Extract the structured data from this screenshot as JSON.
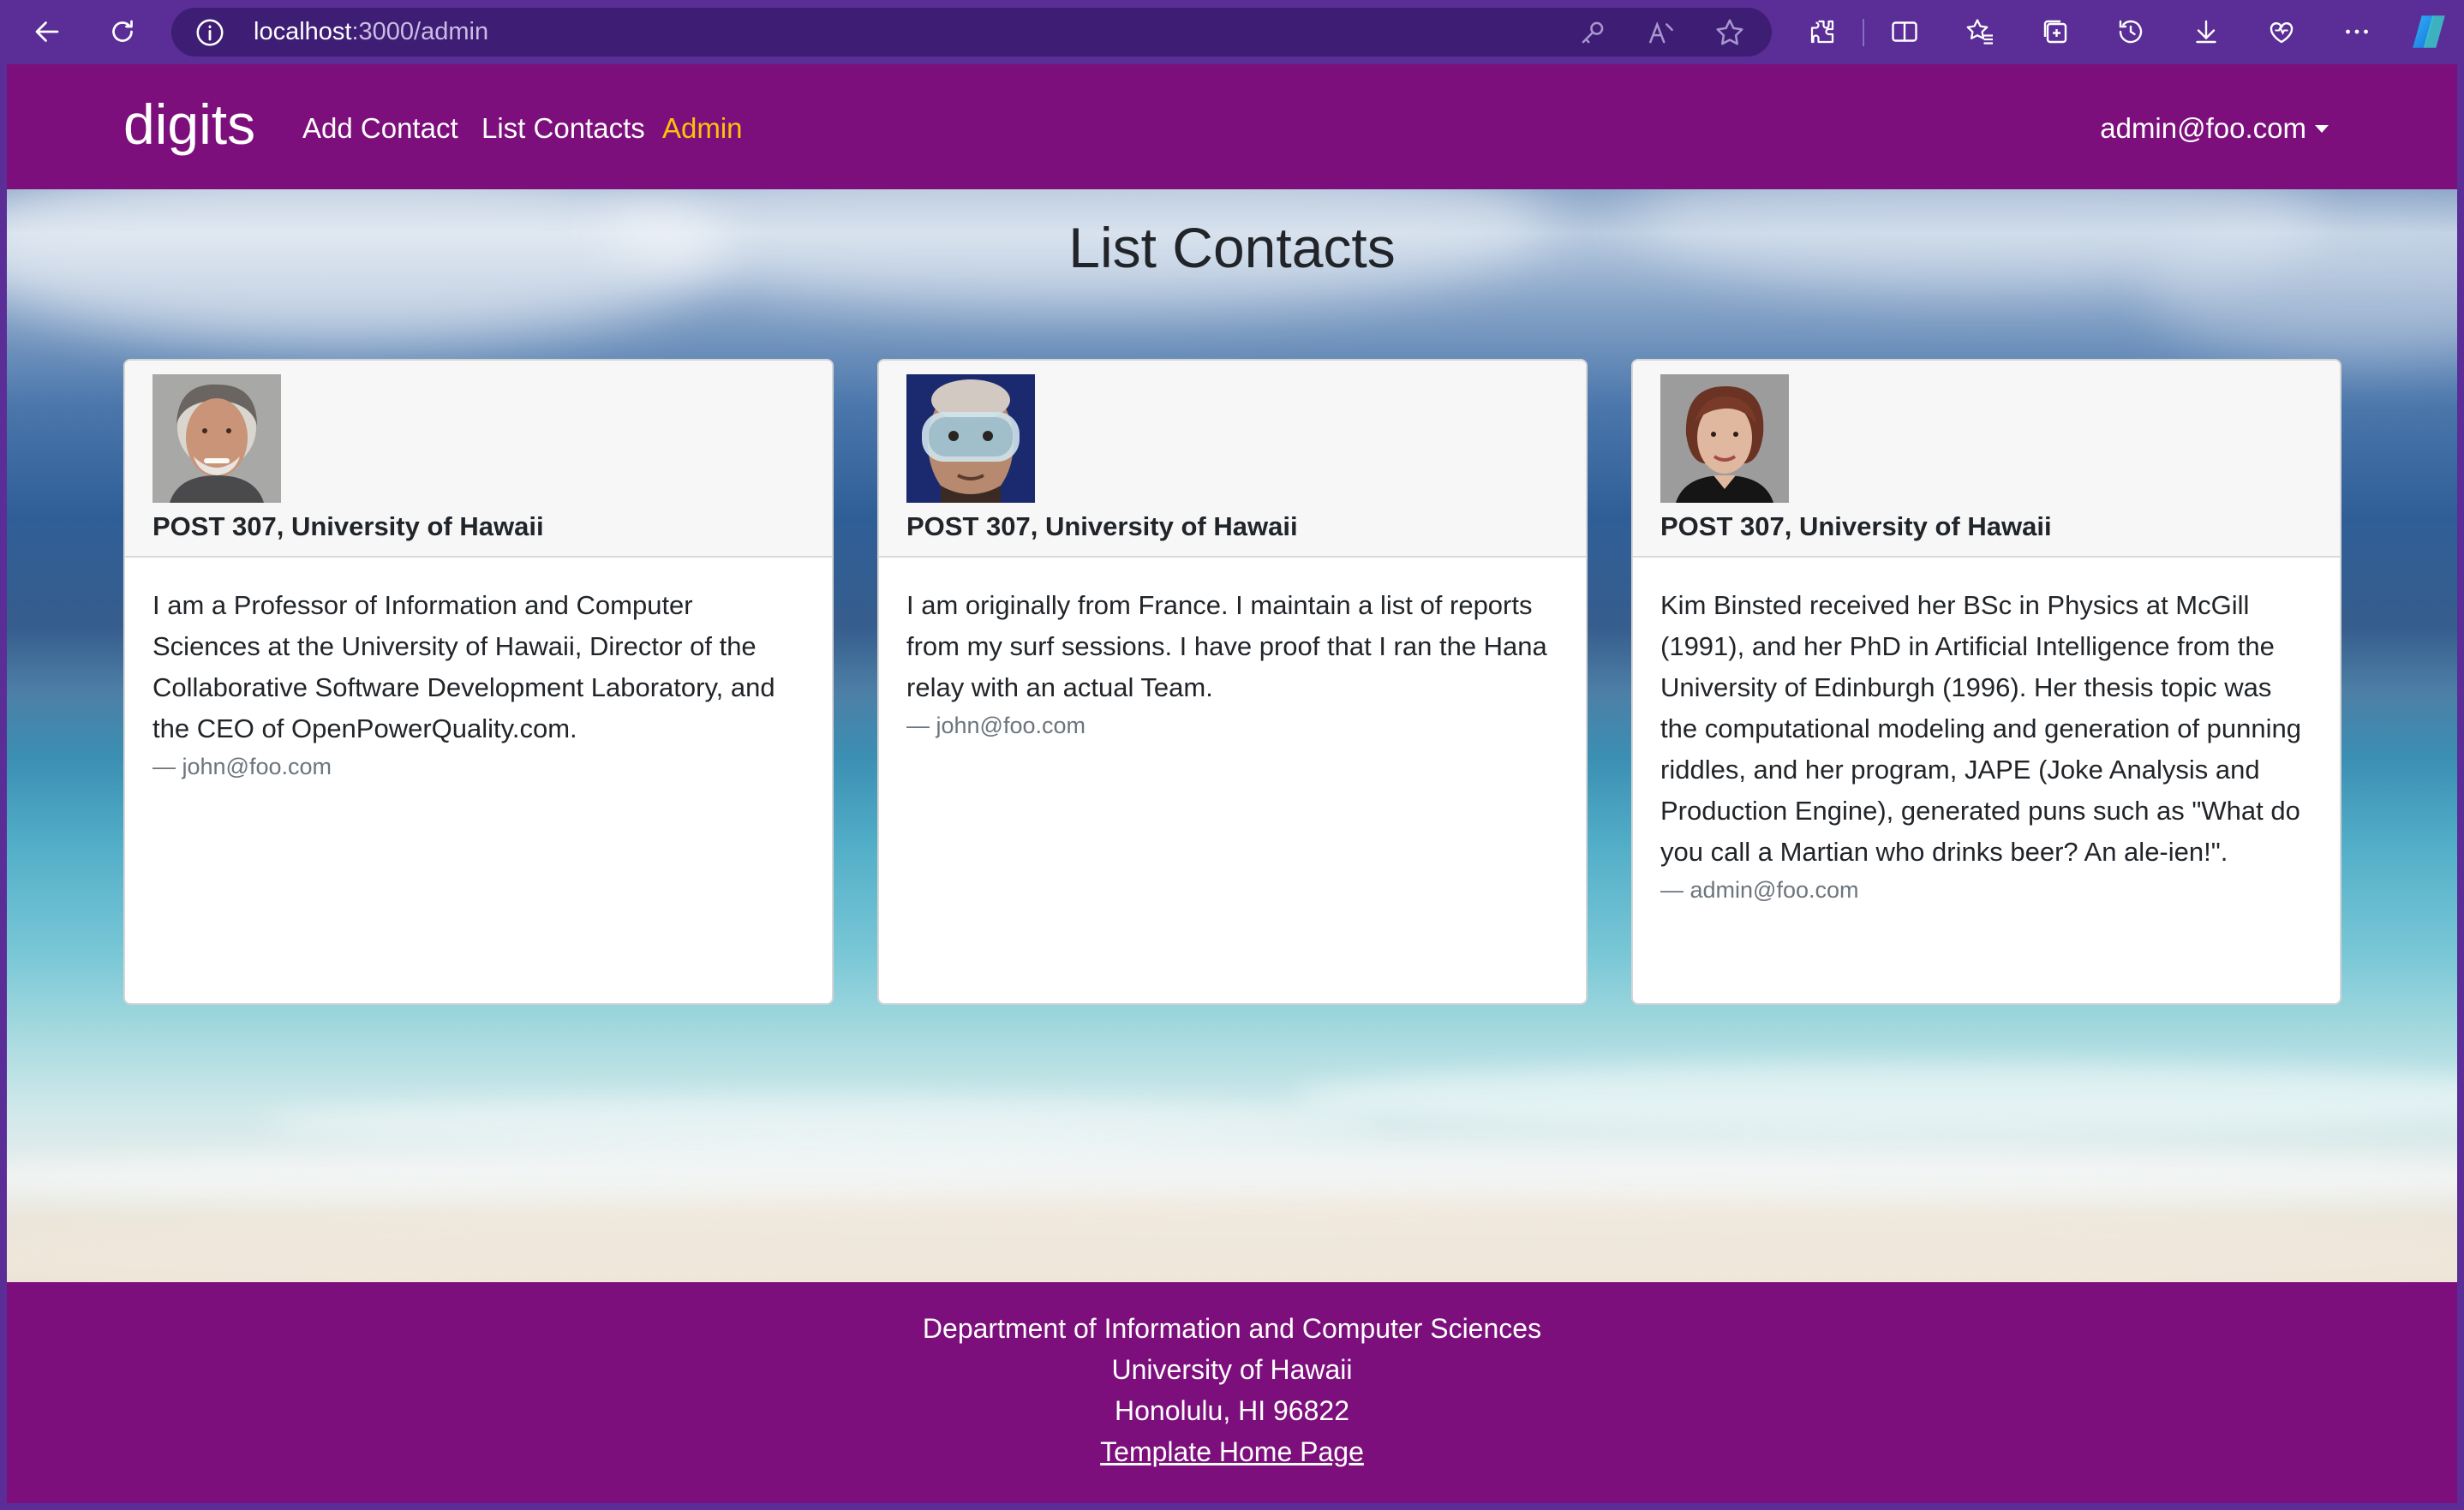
{
  "browser": {
    "url_host": "localhost",
    "url_path": ":3000/admin"
  },
  "navbar": {
    "brand": "digits",
    "links": [
      "Add Contact",
      "List Contacts",
      "Admin"
    ],
    "active": "Admin",
    "user": "admin@foo.com"
  },
  "main": {
    "title": "List Contacts",
    "contacts": [
      {
        "image": "portrait of a smiling grey-haired man",
        "address": "POST 307, University of Hawaii",
        "description": "I am a Professor of Information and Computer Sciences at the University of Hawaii, Director of the Collaborative Software Development Laboratory, and the CEO of OpenPowerQuality.com.",
        "owner": "— john@foo.com"
      },
      {
        "image": "portrait of a man wearing a diving mask",
        "address": "POST 307, University of Hawaii",
        "description": "I am originally from France. I maintain a list of reports from my surf sessions. I have proof that I ran the Hana relay with an actual Team.",
        "owner": "— john@foo.com"
      },
      {
        "image": "portrait of a woman with short auburn hair",
        "address": "POST 307, University of Hawaii",
        "description": "Kim Binsted received her BSc in Physics at McGill (1991), and her PhD in Artificial Intelligence from the University of Edinburgh (1996). Her thesis topic was the computational modeling and generation of punning riddles, and her program, JAPE (Joke Analysis and Production Engine), generated puns such as \"What do you call a Martian who drinks beer? An ale-ien!\".",
        "owner": "— admin@foo.com"
      }
    ]
  },
  "footer": {
    "line1": "Department of Information and Computer Sciences",
    "line2": "University of Hawaii",
    "line3": "Honolulu, HI 96822",
    "link": "Template Home Page"
  },
  "colors": {
    "chrome": "#5a2e96",
    "navbar": "#7d0f7c",
    "active_link": "#ffc107"
  }
}
